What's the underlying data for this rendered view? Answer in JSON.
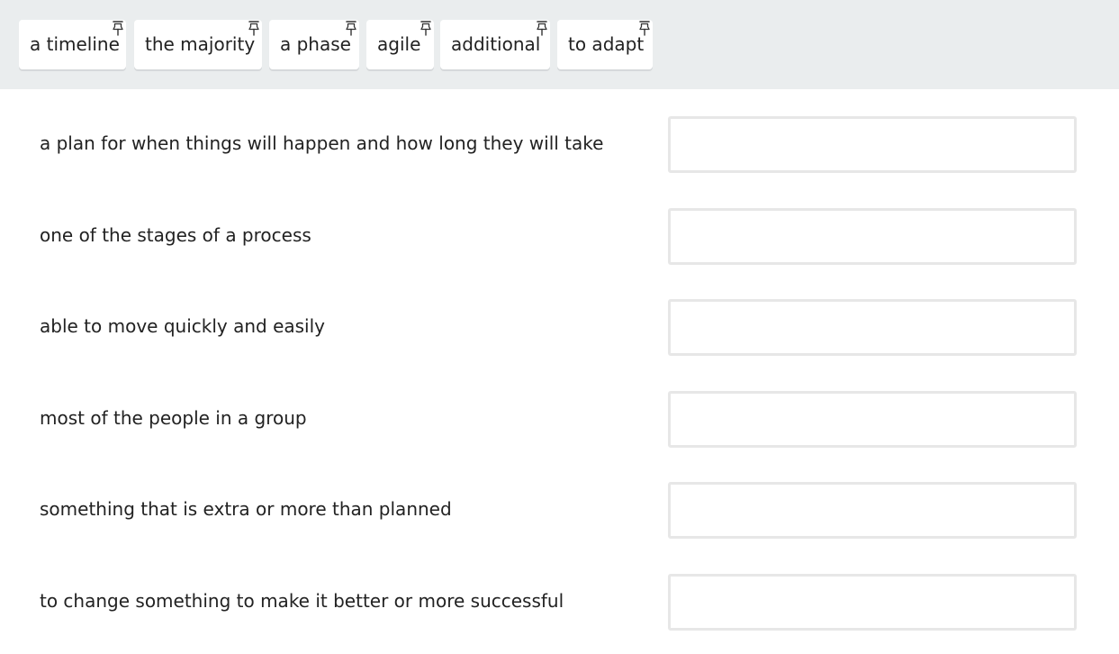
{
  "word_bank": {
    "chips": [
      {
        "label": "a timeline"
      },
      {
        "label": "the majority"
      },
      {
        "label": "a phase"
      },
      {
        "label": "agile"
      },
      {
        "label": "additional"
      },
      {
        "label": "to adapt"
      }
    ],
    "chip_icon": "pin-icon"
  },
  "rows": [
    {
      "definition": "a plan for when things will happen and how long they will take",
      "answer": ""
    },
    {
      "definition": "one of the stages of a process",
      "answer": ""
    },
    {
      "definition": "able to move quickly and easily",
      "answer": ""
    },
    {
      "definition": "most of the people in a group",
      "answer": ""
    },
    {
      "definition": "something that is extra or more than planned",
      "answer": ""
    },
    {
      "definition": "to change something to make it better or more successful",
      "answer": ""
    }
  ],
  "colors": {
    "bank_background": "#eaedee",
    "chip_background": "#ffffff",
    "drop_border": "#e7e7e7",
    "text": "#222222"
  }
}
